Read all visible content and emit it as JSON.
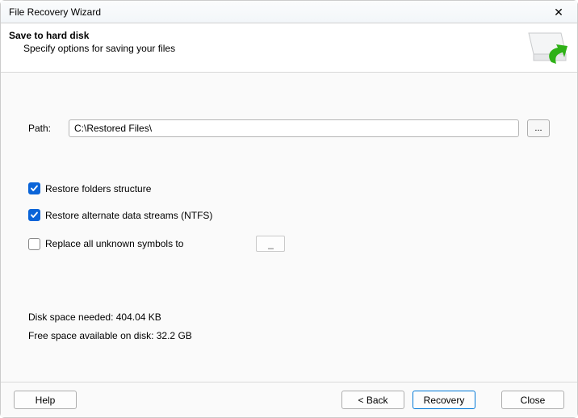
{
  "window": {
    "title": "File Recovery Wizard"
  },
  "header": {
    "title": "Save to hard disk",
    "subtitle": "Specify options for saving your files"
  },
  "path": {
    "label": "Path:",
    "value": "C:\\Restored Files\\",
    "browse_label": "..."
  },
  "options": {
    "restore_folders": {
      "label": "Restore folders structure",
      "checked": true
    },
    "restore_ads": {
      "label": "Restore alternate data streams (NTFS)",
      "checked": true
    },
    "replace_symbols": {
      "label": "Replace all unknown symbols to",
      "checked": false,
      "value": "_"
    }
  },
  "disk": {
    "needed": "Disk space needed: 404.04 KB",
    "free": "Free space available on disk: 32.2 GB"
  },
  "buttons": {
    "help": "Help",
    "back": "< Back",
    "recovery": "Recovery",
    "close": "Close"
  }
}
